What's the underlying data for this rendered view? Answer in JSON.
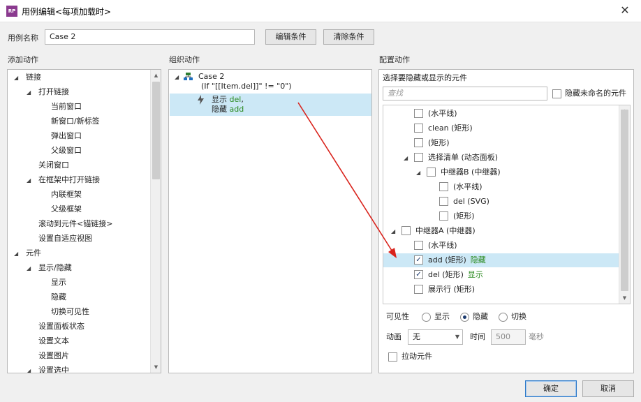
{
  "window": {
    "app_icon_text": "RP",
    "title": "用例编辑<每项加载时>",
    "close_glyph": "✕"
  },
  "case_name": {
    "label": "用例名称",
    "value": "Case 2",
    "edit_condition_button": "编辑条件",
    "clear_condition_button": "清除条件"
  },
  "sections": {
    "add_actions": "添加动作",
    "organize_actions": "组织动作",
    "configure_actions": "配置动作"
  },
  "add_actions_tree": [
    {
      "label": "链接",
      "level": 0,
      "expanded": true
    },
    {
      "label": "打开链接",
      "level": 1,
      "expanded": true
    },
    {
      "label": "当前窗口",
      "level": 2
    },
    {
      "label": "新窗口/新标签",
      "level": 2
    },
    {
      "label": "弹出窗口",
      "level": 2
    },
    {
      "label": "父级窗口",
      "level": 2
    },
    {
      "label": "关闭窗口",
      "level": 1
    },
    {
      "label": "在框架中打开链接",
      "level": 1,
      "expanded": true
    },
    {
      "label": "内联框架",
      "level": 2
    },
    {
      "label": "父级框架",
      "level": 2
    },
    {
      "label": "滚动到元件<锚链接>",
      "level": 1
    },
    {
      "label": "设置自适应视图",
      "level": 1
    },
    {
      "label": "元件",
      "level": 0,
      "expanded": true
    },
    {
      "label": "显示/隐藏",
      "level": 1,
      "expanded": true
    },
    {
      "label": "显示",
      "level": 2
    },
    {
      "label": "隐藏",
      "level": 2
    },
    {
      "label": "切换可见性",
      "level": 2
    },
    {
      "label": "设置面板状态",
      "level": 1
    },
    {
      "label": "设置文本",
      "level": 1
    },
    {
      "label": "设置图片",
      "level": 1
    },
    {
      "label": "设置选中",
      "level": 1,
      "expanded": true
    }
  ],
  "organize": {
    "case_label": "Case 2",
    "condition": "(If \"[[Item.del]]\" != \"0\")",
    "action_show_prefix": "显示 ",
    "action_show_target": "del",
    "action_show_suffix": ",",
    "action_hide_prefix": "隐藏 ",
    "action_hide_target": "add"
  },
  "configure": {
    "prompt": "选择要隐藏或显示的元件",
    "search_placeholder": "查找",
    "hide_unnamed_label": "隐藏未命名的元件",
    "widgets": [
      {
        "label": "(水平线)",
        "level": 2,
        "checked": false
      },
      {
        "label": "clean (矩形)",
        "level": 2,
        "checked": false
      },
      {
        "label": "(矩形)",
        "level": 2,
        "checked": false
      },
      {
        "label": "选择清单 (动态面板)",
        "level": 2,
        "checked": false,
        "expanded": true
      },
      {
        "label": "中继器B (中继器)",
        "level": 3,
        "checked": false,
        "expanded": true
      },
      {
        "label": "(水平线)",
        "level": 4,
        "checked": false
      },
      {
        "label": "del (SVG)",
        "level": 4,
        "checked": false
      },
      {
        "label": "(矩形)",
        "level": 4,
        "checked": false
      },
      {
        "label": "中继器A (中继器)",
        "level": 1,
        "checked": false,
        "expanded": true
      },
      {
        "label": "(水平线)",
        "level": 2,
        "checked": false
      },
      {
        "label": "add (矩形)",
        "level": 2,
        "checked": true,
        "status": "隐藏",
        "selected": true
      },
      {
        "label": "del (矩形)",
        "level": 2,
        "checked": true,
        "status": "显示"
      },
      {
        "label": "展示行 (矩形)",
        "level": 2,
        "checked": false
      }
    ],
    "visibility_label": "可见性",
    "vis_show": "显示",
    "vis_hide": "隐藏",
    "vis_toggle": "切换",
    "visibility_selected": "隐藏",
    "animation_label": "动画",
    "animation_value": "无",
    "time_label": "时间",
    "time_value": "500",
    "time_unit": "毫秒",
    "drag_widget_label": "拉动元件"
  },
  "footer": {
    "ok_button": "确定",
    "cancel_button": "取消"
  },
  "colors": {
    "accent_green": "#2a8a1f",
    "selection_blue": "#cce8f6",
    "arrow_red": "#d9231c"
  }
}
